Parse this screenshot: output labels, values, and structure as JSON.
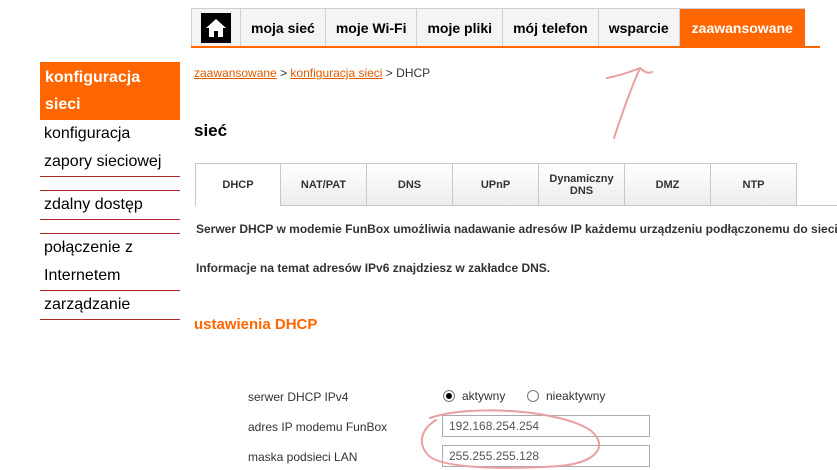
{
  "topnav": {
    "tabs": [
      {
        "label": "moja sieć"
      },
      {
        "label": "moje Wi-Fi"
      },
      {
        "label": "moje pliki"
      },
      {
        "label": "mój telefon"
      },
      {
        "label": "wsparcie"
      },
      {
        "label": "zaawansowane",
        "active": true
      }
    ]
  },
  "sidebar": {
    "active_line1": "konfiguracja",
    "active_line2": "sieci",
    "items": [
      {
        "line1": "konfiguracja",
        "line2": "zapory sieciowej"
      },
      {
        "line1": "zdalny dostęp"
      },
      {
        "line1": "połączenie z",
        "line2": "Internetem"
      },
      {
        "line1": "zarządzanie"
      }
    ]
  },
  "breadcrumb": {
    "link1": "zaawansowane",
    "sep1": " > ",
    "link2": "konfiguracja sieci",
    "sep2": " > ",
    "current": "DHCP"
  },
  "page_title": "sieć",
  "subtabs": [
    {
      "label": "DHCP",
      "active": true
    },
    {
      "label": "NAT/PAT"
    },
    {
      "label": "DNS"
    },
    {
      "label": "UPnP"
    },
    {
      "label_line1": "Dynamiczny",
      "label_line2": "DNS"
    },
    {
      "label": "DMZ"
    },
    {
      "label": "NTP"
    }
  ],
  "info": {
    "dhcp_text": "Serwer DHCP w modemie FunBox umożliwia nadawanie adresów IP każdemu urządzeniu podłączonemu do sieci l",
    "ipv6_text": "Informacje na temat adresów IPv6 znajdziesz w zakładce DNS."
  },
  "section_title": "ustawienia DHCP",
  "form": {
    "dhcp_label": "serwer DHCP IPv4",
    "radio_active": "aktywny",
    "radio_inactive": "nieaktywny",
    "selected": "aktywny",
    "ip_label": "adres IP modemu FunBox",
    "ip_value": "192.168.254.254",
    "mask_label": "maska podsieci LAN",
    "mask_value": "255.255.255.128"
  },
  "colors": {
    "accent": "#ff6600",
    "annotation": "#e8a0a0",
    "divider": "#b02a2a"
  }
}
